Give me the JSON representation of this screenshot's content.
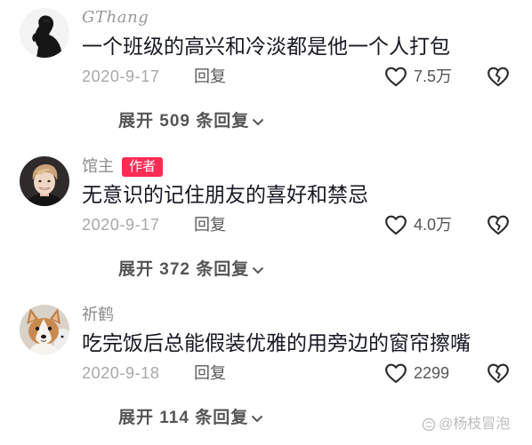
{
  "comments": [
    {
      "username": "GThang",
      "text": "一个班级的高兴和冷淡都是他一个人打包",
      "date": "2020-9-17",
      "reply_label": "回复",
      "likes": "7.5万",
      "expand_label": "展开 509 条回复"
    },
    {
      "username": "馆主",
      "badge": "作者",
      "text": "无意识的记住朋友的喜好和禁忌",
      "date": "2020-9-17",
      "reply_label": "回复",
      "likes": "4.0万",
      "expand_label": "展开 372 条回复"
    },
    {
      "username": "祈鹤",
      "text": "吃完饭后总能假装优雅的用旁边的窗帘擦嘴",
      "date": "2020-9-18",
      "reply_label": "回复",
      "likes": "2299",
      "expand_label": "展开 114 条回复"
    }
  ],
  "icons": {
    "like": "heart-outline-icon",
    "dislike": "broken-heart-icon",
    "expand": "chevron-down-icon",
    "watermark": "watermark-logo-icon"
  },
  "colors": {
    "body_text": "#161823",
    "muted_text": "#a8a8a8",
    "action_text": "#555555",
    "author_badge_bg": "#fe2c55",
    "author_badge_text": "#ffffff"
  },
  "watermark": "@杨枝冒泡"
}
